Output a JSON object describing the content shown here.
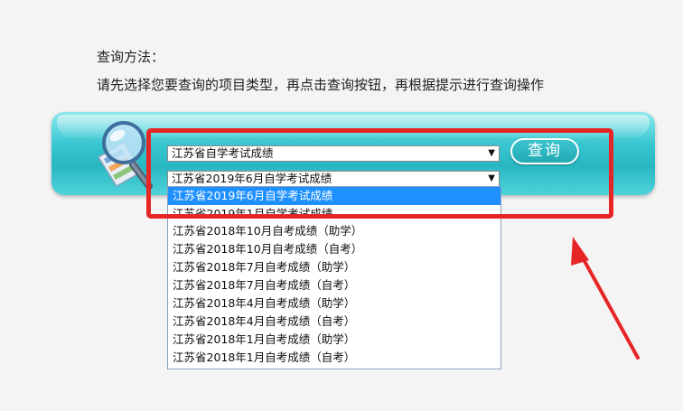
{
  "instructions": {
    "title": "查询方法：",
    "text": "请先选择您要查询的项目类型，再点击查询按钮，再根据提示进行查询操作"
  },
  "form": {
    "type_select_value": "江苏省自学考试成绩",
    "project_select_value": "江苏省2019年6月自学考试成绩",
    "query_button_label": "查询"
  },
  "dropdown": {
    "highlighted_option": "江苏省2019年6月自学考试成绩",
    "partially_hidden_option": "江苏省2019年1月自学考试成绩",
    "options": [
      "江苏省2018年10月自考成绩（助学）",
      "江苏省2018年10月自考成绩（自考）",
      "江苏省2018年7月自考成绩（助学）",
      "江苏省2018年7月自考成绩（自考）",
      "江苏省2018年4月自考成绩（助学）",
      "江苏省2018年4月自考成绩（自考）",
      "江苏省2018年1月自考成绩（助学）",
      "江苏省2018年1月自考成绩（自考）"
    ]
  },
  "icons": {
    "search": "magnifier-over-document-icon",
    "select_arrow": "▼"
  },
  "colors": {
    "banner": "#39c7d1",
    "highlight": "#1e90ff",
    "annotation": "#e62626"
  }
}
